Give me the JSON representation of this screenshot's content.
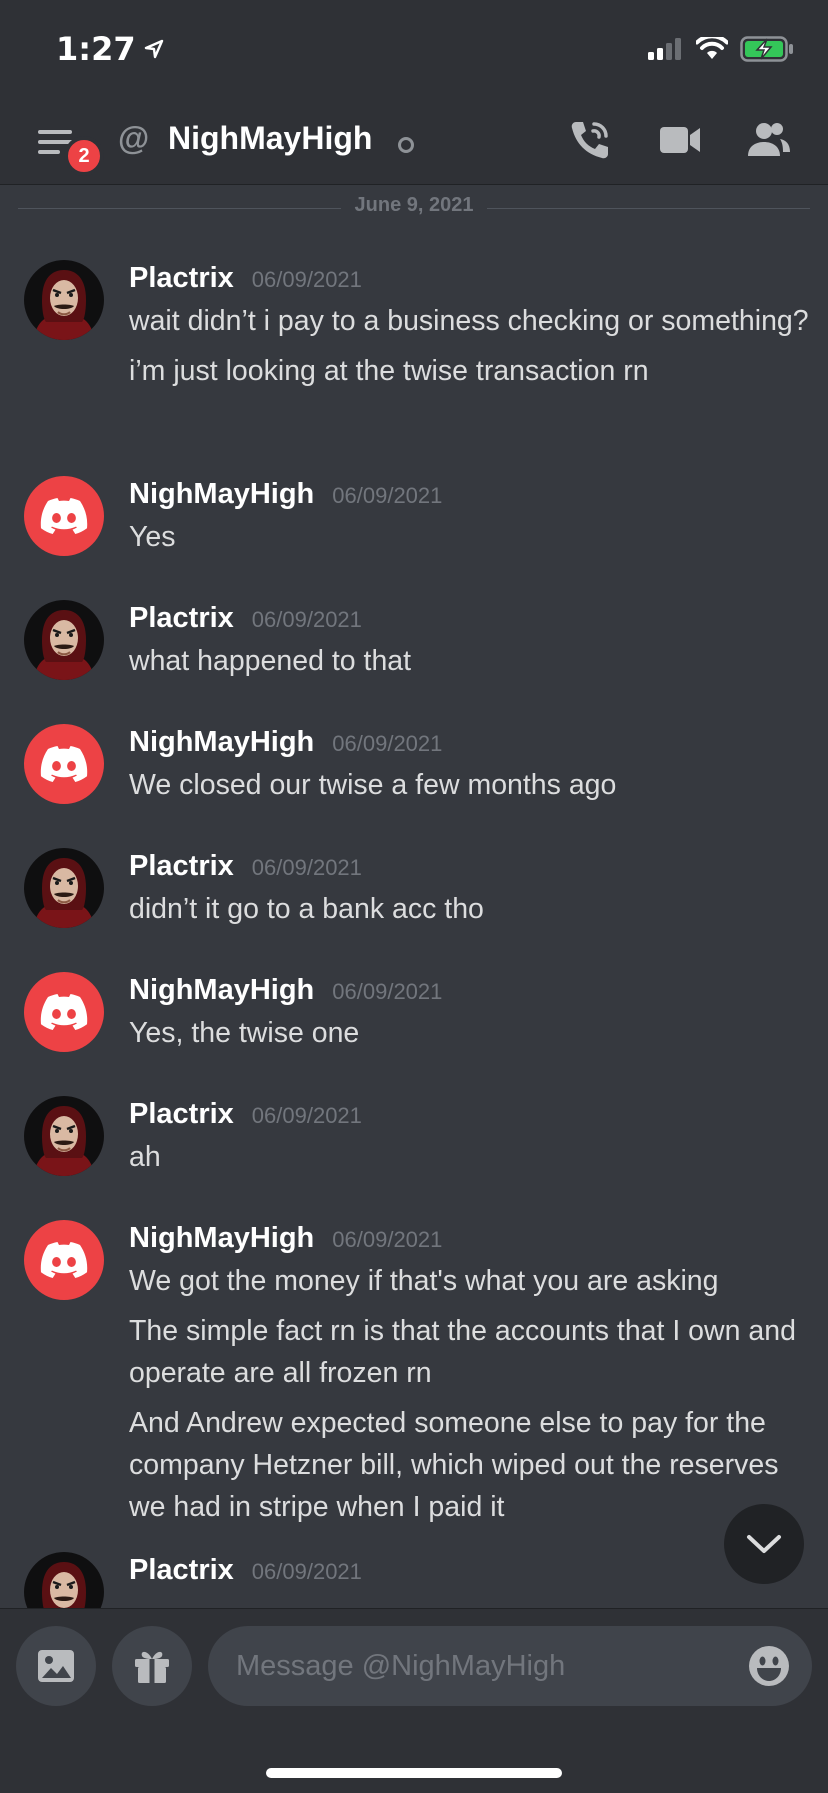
{
  "status_bar": {
    "time": "1:27"
  },
  "header": {
    "badge_count": "2",
    "at_symbol": "@",
    "channel_name": "NighMayHigh"
  },
  "date_divider": "June 9, 2021",
  "messages": [
    {
      "author": "Plactrix",
      "timestamp": "06/09/2021",
      "avatar": "mask-avatar",
      "lines": [
        "wait didn’t i pay to a business checking or something?",
        "i’m just looking at the twise transaction rn"
      ]
    },
    {
      "author": "NighMayHigh",
      "timestamp": "06/09/2021",
      "avatar": "discord-avatar",
      "lines": [
        "Yes"
      ]
    },
    {
      "author": "Plactrix",
      "timestamp": "06/09/2021",
      "avatar": "mask-avatar",
      "lines": [
        "what happened to that"
      ]
    },
    {
      "author": "NighMayHigh",
      "timestamp": "06/09/2021",
      "avatar": "discord-avatar",
      "lines": [
        "We closed our twise a few months ago"
      ]
    },
    {
      "author": "Plactrix",
      "timestamp": "06/09/2021",
      "avatar": "mask-avatar",
      "lines": [
        "didn’t it go to a bank acc tho"
      ]
    },
    {
      "author": "NighMayHigh",
      "timestamp": "06/09/2021",
      "avatar": "discord-avatar",
      "lines": [
        "Yes, the twise one"
      ]
    },
    {
      "author": "Plactrix",
      "timestamp": "06/09/2021",
      "avatar": "mask-avatar",
      "lines": [
        "ah"
      ]
    },
    {
      "author": "NighMayHigh",
      "timestamp": "06/09/2021",
      "avatar": "discord-avatar",
      "lines": [
        "We got the money if that's what you are asking",
        "The simple fact rn is that the accounts that I own and operate are all frozen rn",
        "And Andrew expected someone else to pay for the company Hetzner bill, which wiped out the reserves we had in stripe when I paid it"
      ]
    },
    {
      "author": "Plactrix",
      "timestamp": "06/09/2021",
      "avatar": "mask-avatar",
      "lines": []
    }
  ],
  "composer": {
    "placeholder": "Message @NighMayHigh"
  },
  "colors": {
    "background": "#36393f",
    "header": "#2f3136",
    "discord_red": "#ed4245",
    "battery_green": "#34c759"
  },
  "icons": [
    "location-arrow-icon",
    "signal-icon",
    "wifi-icon",
    "battery-charging-icon",
    "hamburger-icon",
    "call-icon",
    "video-icon",
    "members-icon",
    "image-icon",
    "gift-icon",
    "emoji-icon",
    "chevron-down-icon"
  ]
}
